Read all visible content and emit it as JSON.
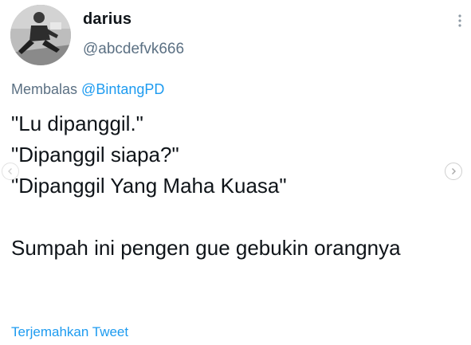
{
  "user": {
    "display_name": "darius",
    "handle": "@abcdefvk666"
  },
  "reply": {
    "prefix": "Membalas",
    "mention": "@BintangPD"
  },
  "tweet": {
    "text": "\"Lu dipanggil.\"\n\"Dipanggil siapa?\"\n\"Dipanggil Yang Maha Kuasa\"\n\nSumpah ini pengen gue gebukin orangnya"
  },
  "actions": {
    "translate_label": "Terjemahkan Tweet"
  },
  "icons": {
    "more": "more-vertical-icon",
    "prev": "chevron-left-icon",
    "next": "chevron-right-icon"
  },
  "colors": {
    "link": "#1d9bf0",
    "secondary_text": "#5b7083",
    "primary_text": "#0f1419"
  }
}
